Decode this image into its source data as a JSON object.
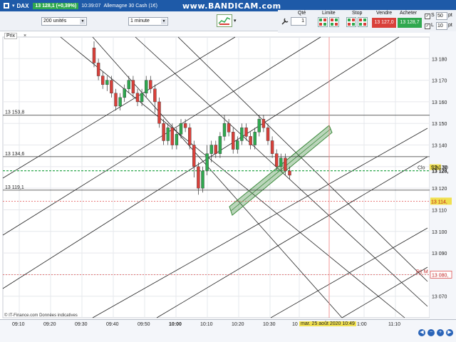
{
  "titlebar": {
    "symbol": "DAX",
    "price_change": "13 128,1 (+0,39%)",
    "time": "10:39:07",
    "instrument": "Allemagne 30 Cash (1€)",
    "overlay": "www.BANDICAM.com"
  },
  "toolbar": {
    "units_select": "200 unités",
    "interval_select": "1 minute"
  },
  "order_panel": {
    "qty_label": "Qté",
    "qty_value": "1",
    "limit_label": "Limite",
    "stop_label": "Stop",
    "sell_label": "Vendre",
    "sell_price": "13 127,0",
    "buy_label": "Acheter",
    "buy_price": "13 128,7",
    "s_label": "S",
    "l_label": "L",
    "s_value": "50",
    "l_value": "10",
    "s_unit": "pt",
    "l_unit": "pt"
  },
  "chart": {
    "price_label": "Prix",
    "close_glyph": "×",
    "levels": [
      {
        "label": "13 153,8",
        "value": 13153.8
      },
      {
        "label": "13 134,6",
        "value": 13134.6
      },
      {
        "label": "13 119,1",
        "value": 13119.1
      }
    ],
    "right_axis": [
      "13 180",
      "13 170",
      "13 160",
      "13 150",
      "13 140",
      "13 130",
      "13 120",
      "13 110",
      "13 100",
      "13 090",
      "13 080",
      "13 070"
    ],
    "current_price_tag": "13 128,",
    "clo_label": "Clo",
    "clo_value": "52s",
    "clo_extra": "30",
    "pivot_tag": "13 114,",
    "r1_label": "R1 M",
    "r1_tag": "13 080,",
    "watermark": "© IT-Finance.com Données indicatives",
    "colors": {
      "up": "#2fa84f",
      "down": "#d9403a",
      "channel": "#3c8a3c",
      "grid": "#e6e8ec"
    }
  },
  "x_axis": {
    "labels": [
      "09:10",
      "09:20",
      "09:30",
      "09:40",
      "09:50",
      "10:00",
      "10:10",
      "10:20",
      "10:30",
      "10",
      "1:00",
      "11:10"
    ],
    "date_tip": "mar. 25 août 2020 10:49"
  },
  "chart_data": {
    "type": "candlestick",
    "y_range": [
      13060,
      13190
    ],
    "candles": [
      [
        13185,
        13178,
        13188,
        13176
      ],
      [
        13178,
        13172,
        13180,
        13170
      ],
      [
        13172,
        13168,
        13174,
        13166
      ],
      [
        13168,
        13170,
        13172,
        13165
      ],
      [
        13170,
        13164,
        13172,
        13162
      ],
      [
        13164,
        13158,
        13166,
        13156
      ],
      [
        13158,
        13162,
        13164,
        13156
      ],
      [
        13162,
        13166,
        13168,
        13160
      ],
      [
        13166,
        13170,
        13172,
        13164
      ],
      [
        13170,
        13164,
        13172,
        13162
      ],
      [
        13164,
        13160,
        13166,
        13158
      ],
      [
        13160,
        13164,
        13166,
        13158
      ],
      [
        13164,
        13170,
        13172,
        13162
      ],
      [
        13170,
        13166,
        13172,
        13164
      ],
      [
        13166,
        13160,
        13168,
        13155
      ],
      [
        13160,
        13150,
        13162,
        13148
      ],
      [
        13150,
        13142,
        13152,
        13140
      ],
      [
        13142,
        13148,
        13150,
        13140
      ],
      [
        13148,
        13140,
        13150,
        13138
      ],
      [
        13140,
        13145,
        13148,
        13138
      ],
      [
        13145,
        13150,
        13152,
        13143
      ],
      [
        13150,
        13148,
        13152,
        13146
      ],
      [
        13148,
        13140,
        13150,
        13138
      ],
      [
        13140,
        13130,
        13142,
        13125
      ],
      [
        13130,
        13120,
        13132,
        13117
      ],
      [
        13120,
        13128,
        13130,
        13118
      ],
      [
        13128,
        13136,
        13140,
        13126
      ],
      [
        13136,
        13140,
        13142,
        13132
      ],
      [
        13140,
        13136,
        13142,
        13134
      ],
      [
        13136,
        13144,
        13146,
        13134
      ],
      [
        13144,
        13150,
        13154,
        13142
      ],
      [
        13150,
        13146,
        13152,
        13144
      ],
      [
        13146,
        13138,
        13148,
        13136
      ],
      [
        13138,
        13142,
        13144,
        13136
      ],
      [
        13142,
        13148,
        13150,
        13140
      ],
      [
        13148,
        13144,
        13150,
        13142
      ],
      [
        13144,
        13140,
        13146,
        13138
      ],
      [
        13140,
        13146,
        13148,
        13138
      ],
      [
        13146,
        13152,
        13154,
        13144
      ],
      [
        13152,
        13148,
        13154,
        13146
      ],
      [
        13148,
        13142,
        13150,
        13140
      ],
      [
        13142,
        13136,
        13144,
        13134
      ],
      [
        13136,
        13130,
        13138,
        13128
      ],
      [
        13130,
        13134,
        13136,
        13128
      ],
      [
        13134,
        13128,
        13136,
        13126
      ],
      [
        13128,
        13126,
        13130,
        13124
      ]
    ]
  }
}
